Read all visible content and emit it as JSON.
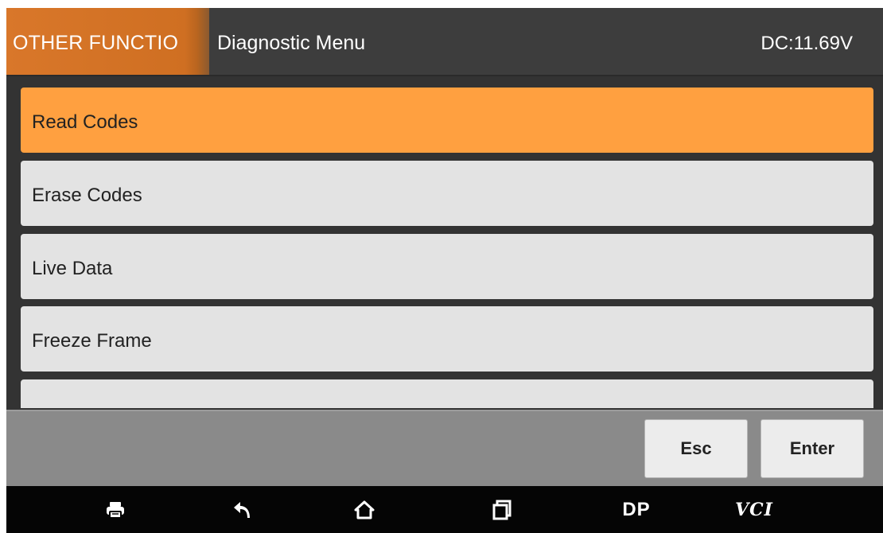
{
  "header": {
    "section_tab": "OTHER FUNCTIO",
    "title": "Diagnostic Menu",
    "voltage": "DC:11.69V"
  },
  "menu": {
    "items": [
      {
        "label": "Read Codes",
        "selected": true
      },
      {
        "label": "Erase Codes",
        "selected": false
      },
      {
        "label": "Live Data",
        "selected": false
      },
      {
        "label": "Freeze Frame",
        "selected": false
      },
      {
        "label": "",
        "selected": false
      }
    ]
  },
  "actions": {
    "esc_label": "Esc",
    "enter_label": "Enter"
  },
  "navbar": {
    "icons": [
      "print-icon",
      "back-icon",
      "home-icon",
      "recent-apps-icon"
    ],
    "dp_label": "DP",
    "vci_label": "VCI"
  },
  "colors": {
    "accent_orange": "#ffa040",
    "tab_orange": "#d9772a",
    "header_bg": "#3d3d3d",
    "list_bg": "#333333",
    "item_bg": "#e3e3e3",
    "action_bar_bg": "#8a8a8a",
    "nav_bg": "#050505"
  }
}
